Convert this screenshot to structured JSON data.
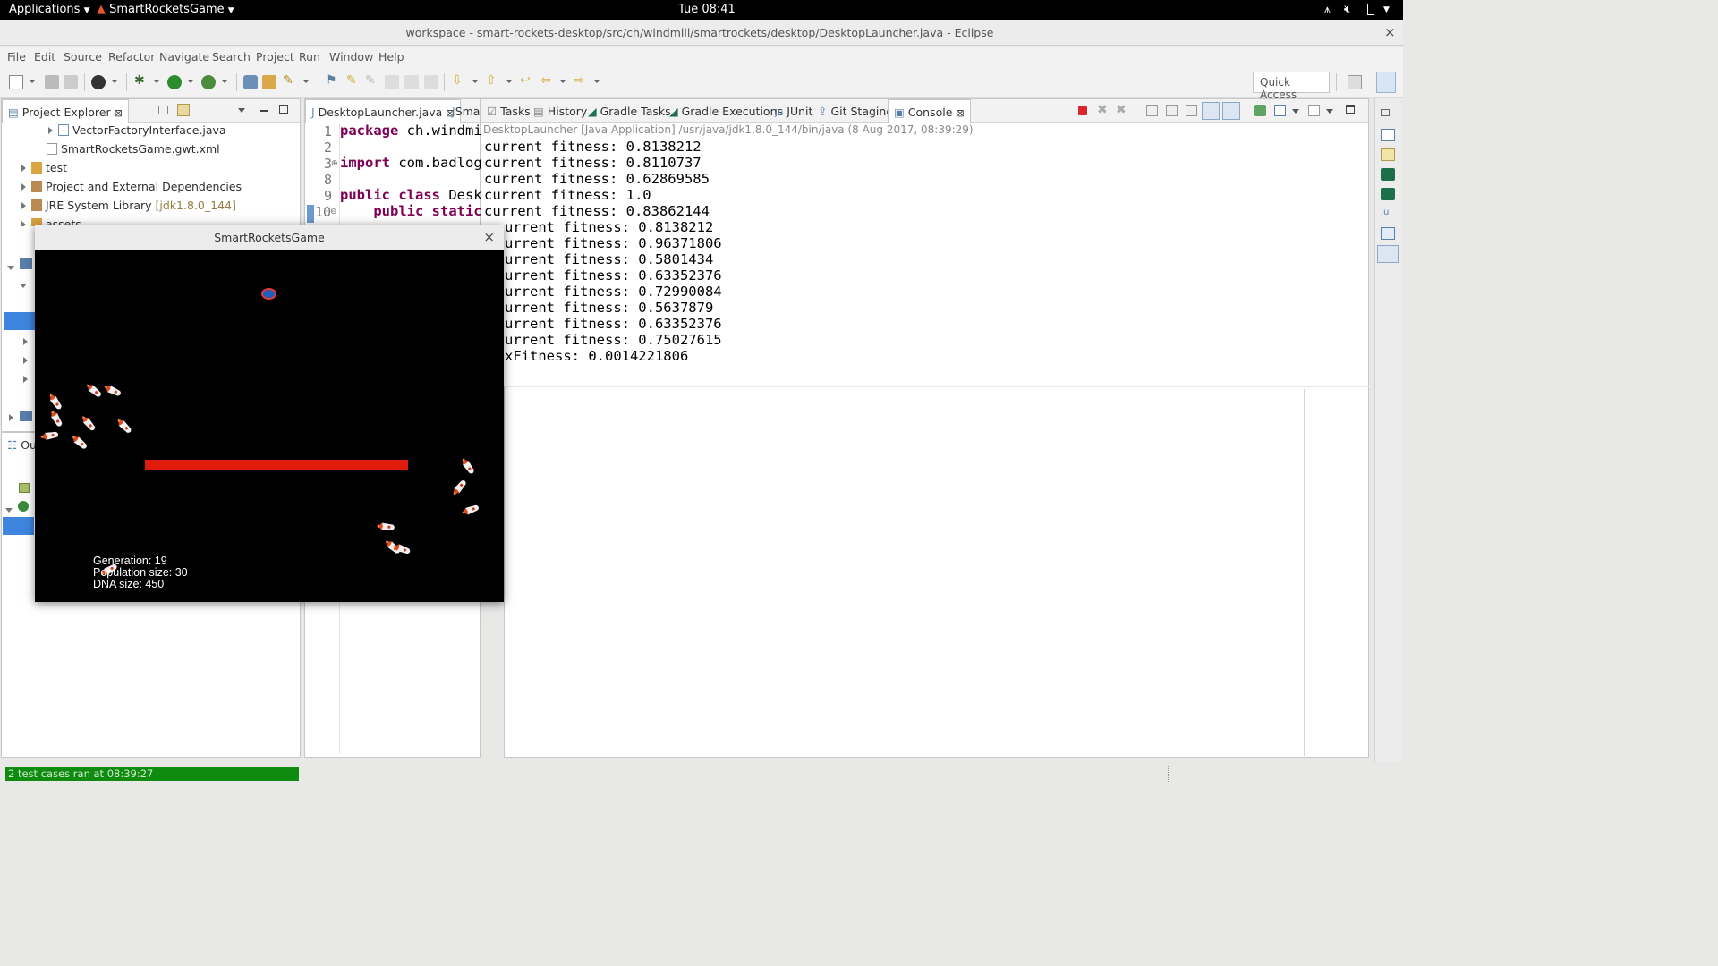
{
  "topbar": {
    "applications": "Applications",
    "app_name": "SmartRocketsGame",
    "clock": "Tue 08:41"
  },
  "window": {
    "title": "workspace - smart-rockets-desktop/src/ch/windmill/smartrockets/desktop/DesktopLauncher.java - Eclipse",
    "close": "×"
  },
  "menu": [
    "File",
    "Edit",
    "Source",
    "Refactor",
    "Navigate",
    "Search",
    "Project",
    "Run",
    "Window",
    "Help"
  ],
  "toolbar": {
    "quick_access": "Quick Access"
  },
  "project_explorer": {
    "tab_label": "Project Explorer",
    "tab_close": "⊠",
    "items": [
      {
        "label": "VectorFactoryInterface.java",
        "suffix": ""
      },
      {
        "label": "SmartRocketsGame.gwt.xml",
        "suffix": ""
      },
      {
        "label": "test",
        "suffix": ""
      },
      {
        "label": "Project and External Dependencies",
        "suffix": ""
      },
      {
        "label": "JRE System Library",
        "suffix": "[jdk1.8.0_144]"
      },
      {
        "label": "assets",
        "suffix": ""
      }
    ]
  },
  "outline": {
    "tab_label": "Out"
  },
  "editor": {
    "tab1": "DesktopLauncher.java",
    "tab1_close": "⊠",
    "tab2": "Sma",
    "line_numbers": [
      "1",
      "2",
      "3",
      "8",
      "9",
      "10"
    ],
    "lines": [
      {
        "kw": "package",
        "rest": " ch.windmi"
      },
      {
        "kw": "",
        "rest": ""
      },
      {
        "kw": "import",
        "rest": " com.badlog"
      },
      {
        "kw": "",
        "rest": ""
      },
      {
        "kw": "public class",
        "rest": " Desk"
      },
      {
        "kw": "    public static",
        "rest": ""
      }
    ]
  },
  "console_tabs": [
    "Tasks",
    "History",
    "Gradle Tasks",
    "Gradle Executions",
    "JUnit",
    "Git Staging",
    "Console"
  ],
  "console": {
    "close": "⊠",
    "header": "DesktopLauncher [Java Application] /usr/java/jdk1.8.0_144/bin/java (8 Aug 2017, 08:39:29)",
    "lines": [
      "current fitness: 0.8138212",
      "current fitness: 0.8110737",
      "current fitness: 0.62869585",
      "current fitness: 1.0",
      "current fitness: 0.83862144",
      "urrent fitness: 0.8138212",
      "urrent fitness: 0.96371806",
      "urrent fitness: 0.5801434",
      "urrent fitness: 0.63352376",
      "urrent fitness: 0.72990084",
      "urrent fitness: 0.5637879",
      "urrent fitness: 0.63352376",
      "urrent fitness: 0.75027615",
      "xFitness: 0.0014221806"
    ]
  },
  "game": {
    "title": "SmartRocketsGame",
    "close": "×",
    "generation": "Generation: 19",
    "population": "Population size: 30",
    "dna": "DNA size: 450"
  },
  "status": {
    "junit": "2 test cases ran at 08:39:27"
  },
  "colors": {
    "obstacle": "#e01b0b",
    "junit_bar": "#0f8c0f",
    "keyword": "#7f0055",
    "selection": "#3d85de"
  }
}
